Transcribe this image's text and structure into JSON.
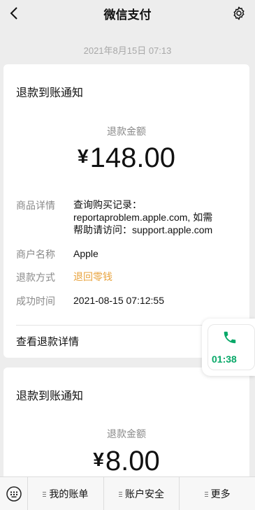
{
  "nav": {
    "title": "微信支付",
    "back_icon": "chevron-left-icon",
    "settings_icon": "gear-icon"
  },
  "timestamp": "2021年8月15日 07:13",
  "notices": [
    {
      "title": "退款到账通知",
      "amount_label": "退款金额",
      "currency": "¥",
      "amount": "148.00",
      "rows": [
        {
          "label": "商品详情",
          "value_lines": [
            "查询购买记录：",
            "reportaproblem.apple.com, 如需",
            "帮助请访问：support.apple.com"
          ]
        },
        {
          "label": "商户名称",
          "value": "Apple"
        },
        {
          "label": "退款方式",
          "value": "退回零钱"
        },
        {
          "label": "成功时间",
          "value": "2021-08-15 07:12:55"
        }
      ],
      "detail_link": "查看退款详情"
    },
    {
      "title": "退款到账通知",
      "amount_label": "退款金额",
      "currency": "¥",
      "amount": "8.00"
    }
  ],
  "floating_call": {
    "icon": "phone-icon",
    "duration": "01:38",
    "accent": "#07a868"
  },
  "bottom_menu": {
    "keyboard_icon": "keyboard-icon",
    "items": [
      "我的账单",
      "账户安全",
      "更多"
    ]
  },
  "colors": {
    "background": "#ededed",
    "refund_method": "#e8a33d",
    "call_green": "#07a868"
  }
}
